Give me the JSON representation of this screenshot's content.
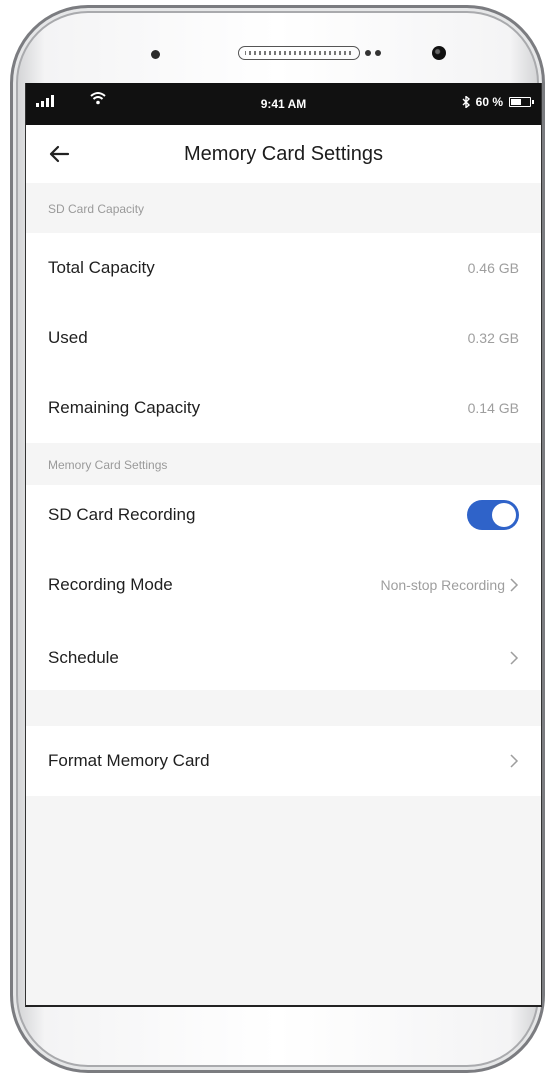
{
  "status_bar": {
    "time": "9:41 AM",
    "battery_text": "60 %",
    "battery_level": 0.6
  },
  "nav": {
    "title": "Memory Card Settings"
  },
  "capacity_section": {
    "header": "SD Card Capacity",
    "rows": [
      {
        "label": "Total Capacity",
        "value": "0.46 GB"
      },
      {
        "label": "Used",
        "value": "0.32 GB"
      },
      {
        "label": "Remaining Capacity",
        "value": "0.14 GB"
      }
    ]
  },
  "settings_section": {
    "header": "Memory Card Settings",
    "sd_recording": {
      "label": "SD Card Recording",
      "enabled": true
    },
    "recording_mode": {
      "label": "Recording Mode",
      "value": "Non-stop Recording"
    },
    "schedule": {
      "label": "Schedule"
    }
  },
  "format": {
    "label": "Format Memory Card"
  },
  "colors": {
    "accent": "#2f63c9",
    "background": "#f5f5f5",
    "status_bar": "#111111"
  },
  "icons": {
    "back": "arrow-left-icon",
    "chevron": "chevron-right-icon",
    "signal": "signal-icon",
    "wifi": "wifi-icon",
    "bluetooth": "bluetooth-icon",
    "battery": "battery-icon"
  }
}
